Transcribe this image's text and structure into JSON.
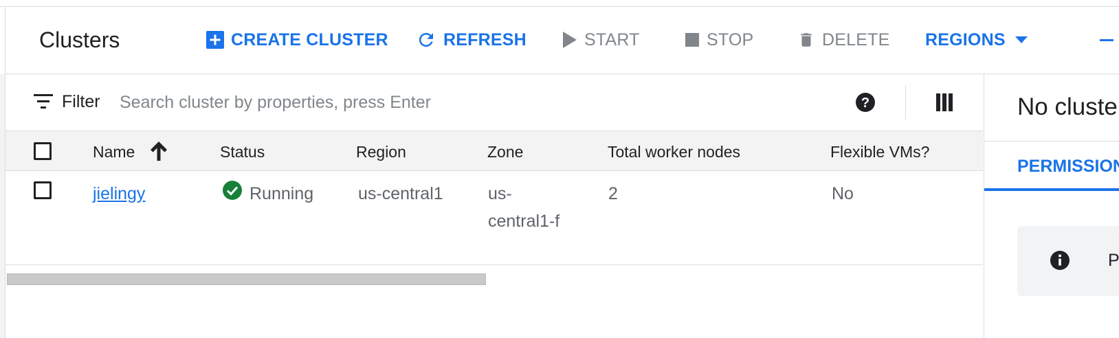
{
  "toolbar": {
    "title": "Clusters",
    "create_label": "CREATE CLUSTER",
    "refresh_label": "REFRESH",
    "start_label": "START",
    "stop_label": "STOP",
    "delete_label": "DELETE",
    "regions_label": "REGIONS"
  },
  "filter": {
    "label": "Filter",
    "placeholder": "Search cluster by properties, press Enter"
  },
  "table": {
    "columns": [
      "Name",
      "Status",
      "Region",
      "Zone",
      "Total worker nodes",
      "Flexible VMs?"
    ],
    "sort_column": "Name",
    "sort_direction": "ascending",
    "rows": [
      {
        "name": "jielingy",
        "status": "Running",
        "region": "us-central1",
        "zone_line1": "us-",
        "zone_line2": "central1-f",
        "total_worker_nodes": "2",
        "flexible_vms": "No"
      }
    ]
  },
  "info_panel": {
    "title": "No cluste",
    "tab": "PERMISSION",
    "notice_text": "P"
  },
  "colors": {
    "accent": "#1a73e8",
    "status_ok": "#188038",
    "disabled": "#80868b"
  }
}
